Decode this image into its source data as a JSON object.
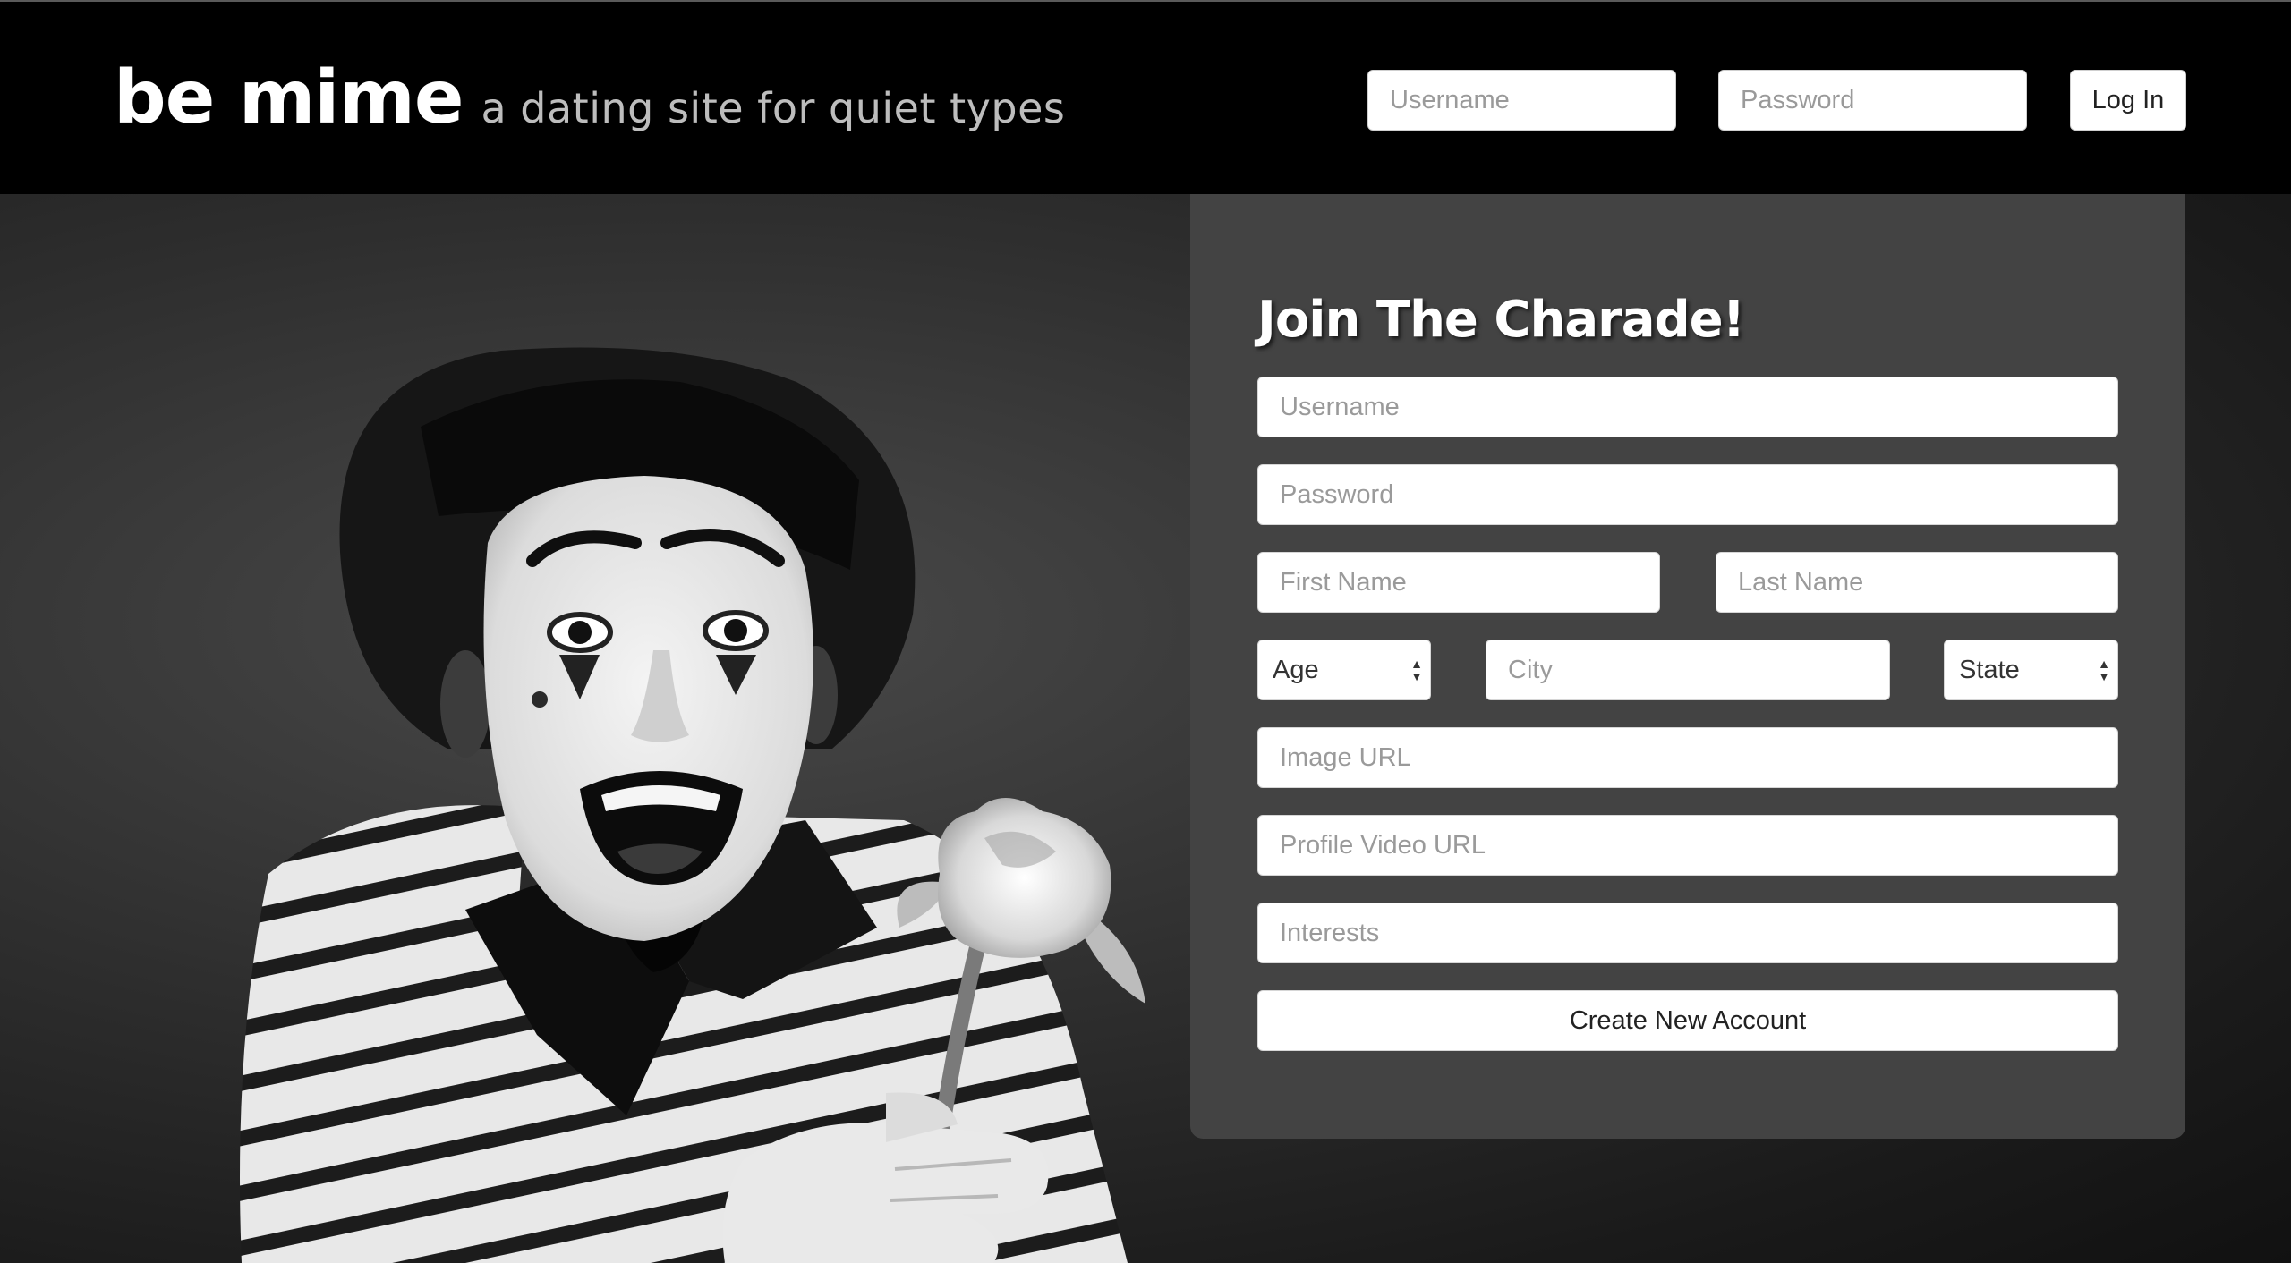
{
  "header": {
    "brand_name": "be mime",
    "tagline": "a dating site for quiet types",
    "login": {
      "username_placeholder": "Username",
      "password_placeholder": "Password",
      "login_label": "Log In"
    }
  },
  "hero": {
    "photo_subject": "mime-holding-rose"
  },
  "signup": {
    "title": "Join The Charade!",
    "username_placeholder": "Username",
    "password_placeholder": "Password",
    "first_name_placeholder": "First Name",
    "last_name_placeholder": "Last Name",
    "age_selected": "Age",
    "city_placeholder": "City",
    "state_selected": "State",
    "image_url_placeholder": "Image URL",
    "profile_video_url_placeholder": "Profile Video URL",
    "interests_placeholder": "Interests",
    "create_label": "Create New Account"
  },
  "colors": {
    "header_bg": "#000000",
    "card_bg": "#434343",
    "input_bg": "#ffffff",
    "placeholder": "#9a9a9a"
  }
}
